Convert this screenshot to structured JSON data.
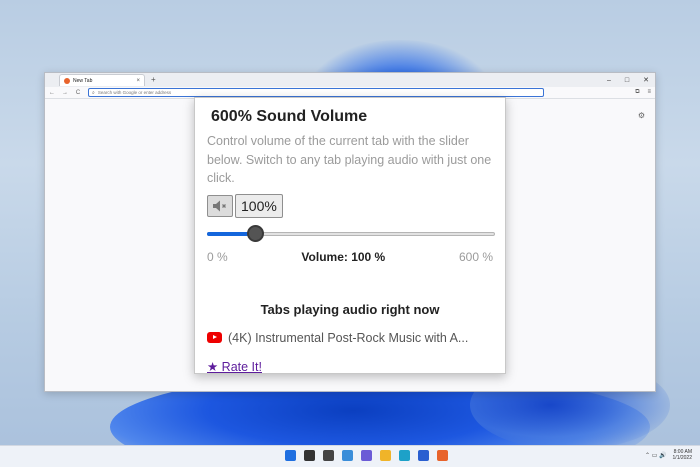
{
  "browser": {
    "tab_title": "New Tab",
    "tab_close": "×",
    "new_tab": "+",
    "window_controls": [
      "–",
      "□",
      "✕"
    ],
    "nav": {
      "back": "←",
      "forward": "→",
      "reload": "C"
    },
    "url_placeholder": "Search with Google or enter address",
    "nav_right": [
      "⧉",
      "≡"
    ],
    "page_gear": "⚙"
  },
  "popup": {
    "title": "600% Sound Volume",
    "description": "Control volume of the current tab with the slider below. Switch to any tab playing audio with just one click.",
    "mute_icon": "speaker-mute-icon",
    "percent_button": "100%",
    "slider": {
      "min": 0,
      "max": 600,
      "value": 100,
      "accent": "#1466dc"
    },
    "scale_min_label": "0 %",
    "volume_label": "Volume: 100 %",
    "scale_max_label": "600 %",
    "tabs_heading": "Tabs playing audio right now",
    "audio_tabs": [
      {
        "icon": "youtube-icon",
        "title": "(4K) Instrumental Post-Rock Music with A..."
      }
    ],
    "rate_link": "★ Rate It!"
  },
  "taskbar": {
    "icons": [
      {
        "name": "start-icon",
        "color": "#1f6fe0"
      },
      {
        "name": "search-icon",
        "color": "#333333"
      },
      {
        "name": "task-view-icon",
        "color": "#444444"
      },
      {
        "name": "widgets-icon",
        "color": "#3a8dd9"
      },
      {
        "name": "chat-icon",
        "color": "#6b5bd6"
      },
      {
        "name": "file-explorer-icon",
        "color": "#f0b429"
      },
      {
        "name": "edge-icon",
        "color": "#1da1c8"
      },
      {
        "name": "store-icon",
        "color": "#2a5fd0"
      },
      {
        "name": "firefox-icon",
        "color": "#e8632b"
      }
    ],
    "time": "8:00 AM",
    "date": "1/1/2022"
  }
}
